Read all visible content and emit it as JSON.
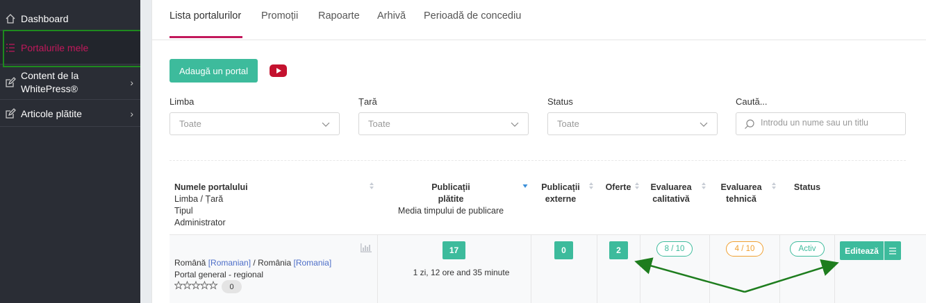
{
  "sidebar": {
    "items": [
      {
        "label": "Dashboard",
        "icon": "home-icon"
      },
      {
        "label": "Portalurile mele",
        "icon": "list-icon",
        "active": true
      },
      {
        "label": "Content de la WhitePress®",
        "icon": "edit-icon"
      },
      {
        "label": "Articole plătite",
        "icon": "edit-icon"
      }
    ]
  },
  "tabs": [
    "Lista portalurilor",
    "Promoții",
    "Rapoarte",
    "Arhivă",
    "Perioadă de concediu"
  ],
  "actions": {
    "add_portal": "Adaugă un portal",
    "video_icon": "youtube-icon"
  },
  "filters": {
    "language": {
      "label": "Limba",
      "value": "Toate"
    },
    "country": {
      "label": "Țară",
      "value": "Toate"
    },
    "status": {
      "label": "Status",
      "value": "Toate"
    },
    "search": {
      "label": "Caută...",
      "placeholder": "Introdu un nume sau un titlu"
    }
  },
  "table": {
    "headers": {
      "name": [
        "Numele portalului",
        "Limba / Țară",
        "Tipul",
        "Administrator"
      ],
      "paid": [
        "Publicații",
        "plătite",
        "Media timpului de publicare"
      ],
      "external": [
        "Publicații",
        "externe"
      ],
      "offers": "Oferte",
      "quality": [
        "Evaluarea",
        "calitativă"
      ],
      "technical": [
        "Evaluarea",
        "tehnică"
      ],
      "status": "Status"
    },
    "row": {
      "language": "Română",
      "language_link": "[Romanian]",
      "separator": "/",
      "country": "România",
      "country_link": "[Romania]",
      "type": "Portal general - regional",
      "rating_count": "0",
      "paid_publications": "17",
      "avg_time": "1 zi, 12 ore and 35 minute",
      "external_publications": "0",
      "offers": "2",
      "quality_rating": "8 / 10",
      "technical_rating": "4 / 10",
      "status": "Activ",
      "edit_label": "Editează"
    }
  },
  "colors": {
    "accent": "#3dbb9c",
    "brand": "#c2185b",
    "sidebar_bg": "#2a2d35",
    "warning": "#f0a030",
    "annotation": "#1e7d1e"
  }
}
